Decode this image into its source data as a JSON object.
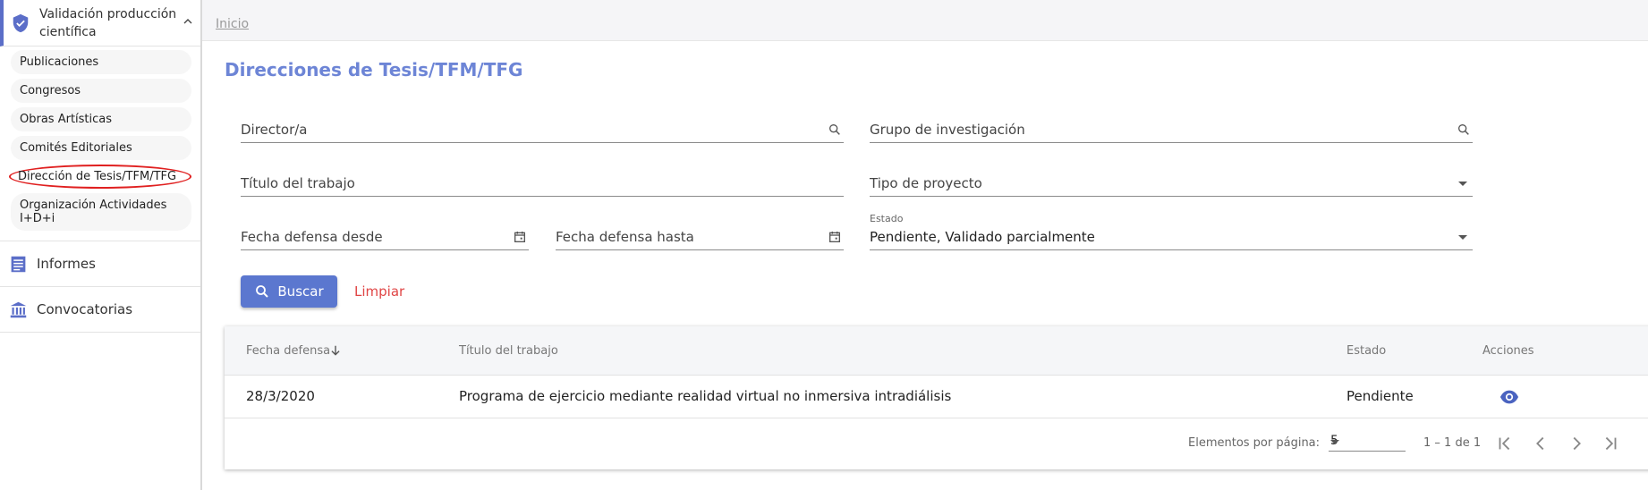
{
  "sidebar": {
    "group_title": "Validación producción científica",
    "items": [
      {
        "label": "Publicaciones"
      },
      {
        "label": "Congresos"
      },
      {
        "label": "Obras Artísticas"
      },
      {
        "label": "Comités Editoriales"
      },
      {
        "label": "Dirección de Tesis/TFM/TFG"
      },
      {
        "label": "Organización Actividades I+D+i"
      }
    ],
    "sections": [
      {
        "label": "Informes",
        "icon": "list-document-icon"
      },
      {
        "label": "Convocatorias",
        "icon": "institution-icon"
      }
    ]
  },
  "breadcrumb": {
    "home": "Inicio"
  },
  "page": {
    "title": "Direcciones de Tesis/TFM/TFG"
  },
  "filters": {
    "director": "Director/a",
    "grupo": "Grupo de investigación",
    "titulo": "Título del trabajo",
    "tipo": "Tipo de proyecto",
    "fecha_desde": "Fecha defensa desde",
    "fecha_hasta": "Fecha defensa hasta",
    "estado_label": "Estado",
    "estado_value": "Pendiente, Validado parcialmente"
  },
  "actions": {
    "search": "Buscar",
    "clear": "Limpiar"
  },
  "table": {
    "headers": {
      "fecha": "Fecha defensa",
      "titulo": "Título del trabajo",
      "estado": "Estado",
      "acciones": "Acciones"
    },
    "rows": [
      {
        "fecha": "28/3/2020",
        "titulo": "Programa de ejercicio mediante realidad virtual no inmersiva intradiálisis",
        "estado": "Pendiente"
      }
    ]
  },
  "paginator": {
    "items_label": "Elementos por página:",
    "page_size": "5",
    "range": "1 – 1 de 1"
  },
  "colors": {
    "accent": "#5b77cf",
    "title": "#6d85d6",
    "clear": "#e04545",
    "highlight": "#e02020"
  }
}
